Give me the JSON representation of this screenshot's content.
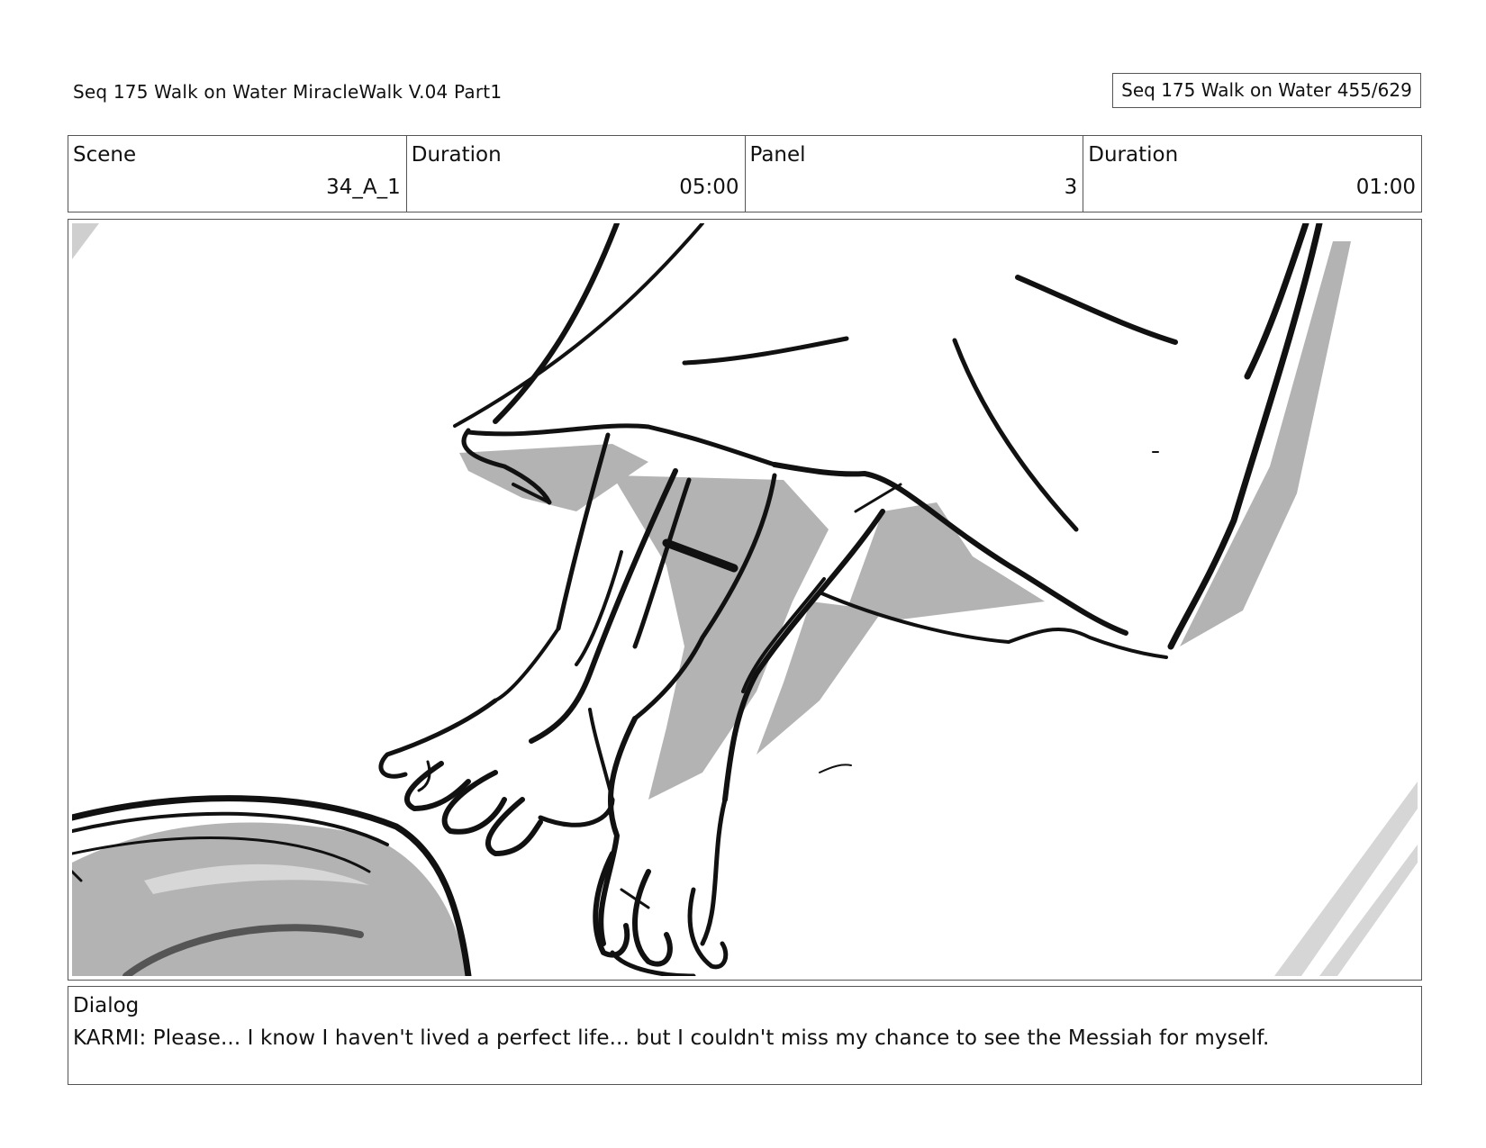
{
  "header": {
    "title": "Seq 175 Walk on Water  MiracleWalk V.04 Part1",
    "page_counter": "Seq 175 Walk on Water 455/629"
  },
  "info": {
    "scene_label": "Scene",
    "scene_value": "34_A_1",
    "duration_label": "Duration",
    "duration_value": "05:00",
    "panel_label": "Panel",
    "panel_value": "3",
    "panel_duration_label": "Duration",
    "panel_duration_value": "01:00"
  },
  "dialog": {
    "label": "Dialog",
    "text": "KARMI: Please... I know I haven't lived a perfect life... but I couldn't miss my chance to see the Messiah for myself."
  },
  "colors": {
    "ink": "#111111",
    "shadow": "#b3b3b3",
    "border": "#555555"
  }
}
